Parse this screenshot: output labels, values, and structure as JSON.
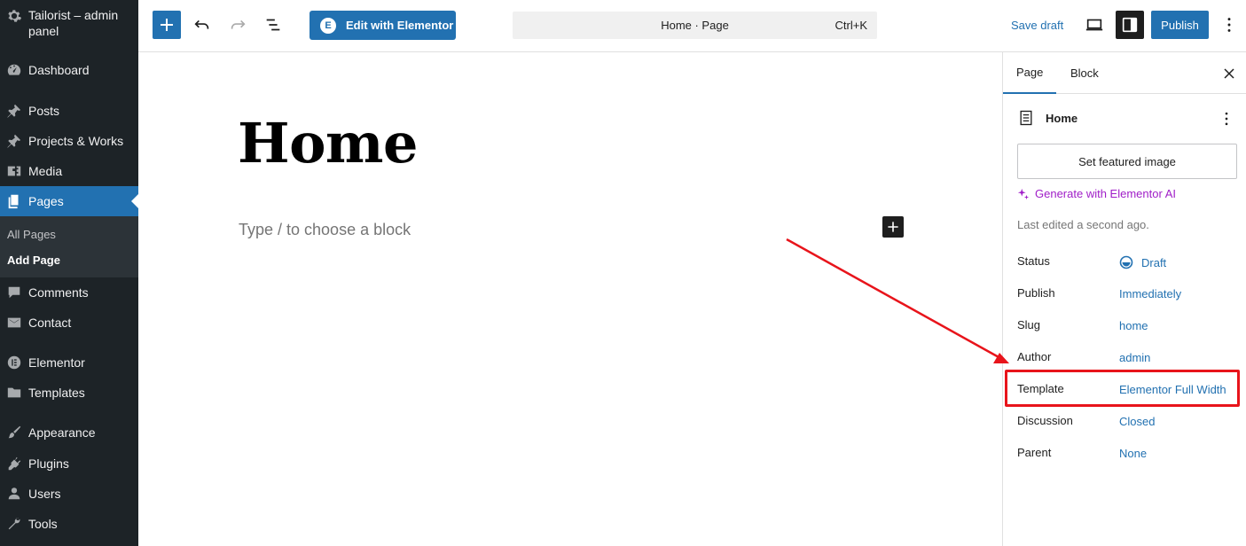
{
  "sidebar": {
    "site_name": "Tailorist – admin panel",
    "items": [
      {
        "label": "Dashboard",
        "icon": "dashboard-icon"
      },
      {
        "label": "Posts",
        "icon": "pin-icon"
      },
      {
        "label": "Projects & Works",
        "icon": "pin-icon"
      },
      {
        "label": "Media",
        "icon": "media-icon"
      },
      {
        "label": "Pages",
        "icon": "pages-icon"
      },
      {
        "label": "Comments",
        "icon": "comments-icon"
      },
      {
        "label": "Contact",
        "icon": "mail-icon"
      },
      {
        "label": "Elementor",
        "icon": "elementor-icon"
      },
      {
        "label": "Templates",
        "icon": "folder-icon"
      },
      {
        "label": "Appearance",
        "icon": "brush-icon"
      },
      {
        "label": "Plugins",
        "icon": "plug-icon"
      },
      {
        "label": "Users",
        "icon": "user-icon"
      },
      {
        "label": "Tools",
        "icon": "wrench-icon"
      }
    ],
    "submenu": [
      {
        "label": "All Pages"
      },
      {
        "label": "Add Page"
      }
    ]
  },
  "topbar": {
    "edit_with_elementor": "Edit with Elementor",
    "command_title": "Home · Page",
    "command_shortcut": "Ctrl+K",
    "save_draft": "Save draft",
    "publish": "Publish"
  },
  "canvas": {
    "title": "Home",
    "placeholder": "Type / to choose a block"
  },
  "panel": {
    "tabs": [
      "Page",
      "Block"
    ],
    "doc_title": "Home",
    "featured_image": "Set featured image",
    "generate_ai": "Generate with Elementor AI",
    "last_edited": "Last edited a second ago.",
    "rows": [
      {
        "key": "Status",
        "value": "Draft"
      },
      {
        "key": "Publish",
        "value": "Immediately"
      },
      {
        "key": "Slug",
        "value": "home"
      },
      {
        "key": "Author",
        "value": "admin"
      },
      {
        "key": "Template",
        "value": "Elementor Full Width"
      },
      {
        "key": "Discussion",
        "value": "Closed"
      },
      {
        "key": "Parent",
        "value": "None"
      }
    ]
  },
  "colors": {
    "sidebar_bg": "#1d2327",
    "accent": "#2271b1",
    "ai_purple": "#a01ec8",
    "annotation_red": "#e8141b"
  }
}
